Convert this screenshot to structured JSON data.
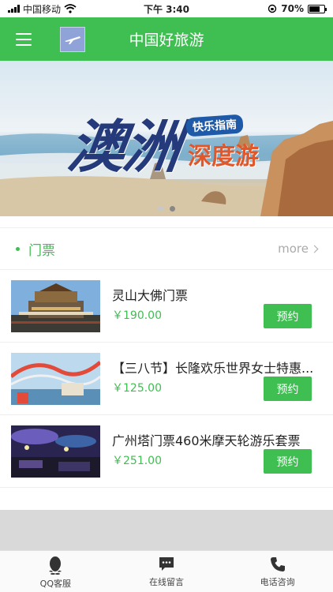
{
  "status": {
    "carrier": "中国移动",
    "time": "下午 3:40",
    "battery": "70%",
    "battery_level": 0.7
  },
  "header": {
    "menu_icon": "hamburger-menu-icon",
    "logo_icon": "airplane-logo-icon",
    "title": "中国好旅游"
  },
  "banner": {
    "title": "澳洲",
    "subtitle": "快乐指南",
    "headline": "深度游",
    "slides": 2,
    "active_slide": 1
  },
  "section": {
    "title": "门票",
    "more_label": "more"
  },
  "products": [
    {
      "name": "灵山大佛门票",
      "price": "￥190.00",
      "button": "预约",
      "thumb": "temple"
    },
    {
      "name": "【三八节】长隆欢乐世界女士特惠...",
      "price": "￥125.00",
      "button": "预约",
      "thumb": "rollercoaster"
    },
    {
      "name": "广州塔门票460米摩天轮游乐套票",
      "price": "￥251.00",
      "button": "预约",
      "thumb": "night-venue"
    }
  ],
  "tabbar": [
    {
      "label": "QQ客服",
      "icon": "qq-penguin-icon"
    },
    {
      "label": "在线留言",
      "icon": "message-bubble-icon"
    },
    {
      "label": "电话咨询",
      "icon": "phone-icon"
    }
  ],
  "colors": {
    "accent": "#3fbe52",
    "price": "#3fbe52",
    "muted": "#aaaaaa"
  }
}
